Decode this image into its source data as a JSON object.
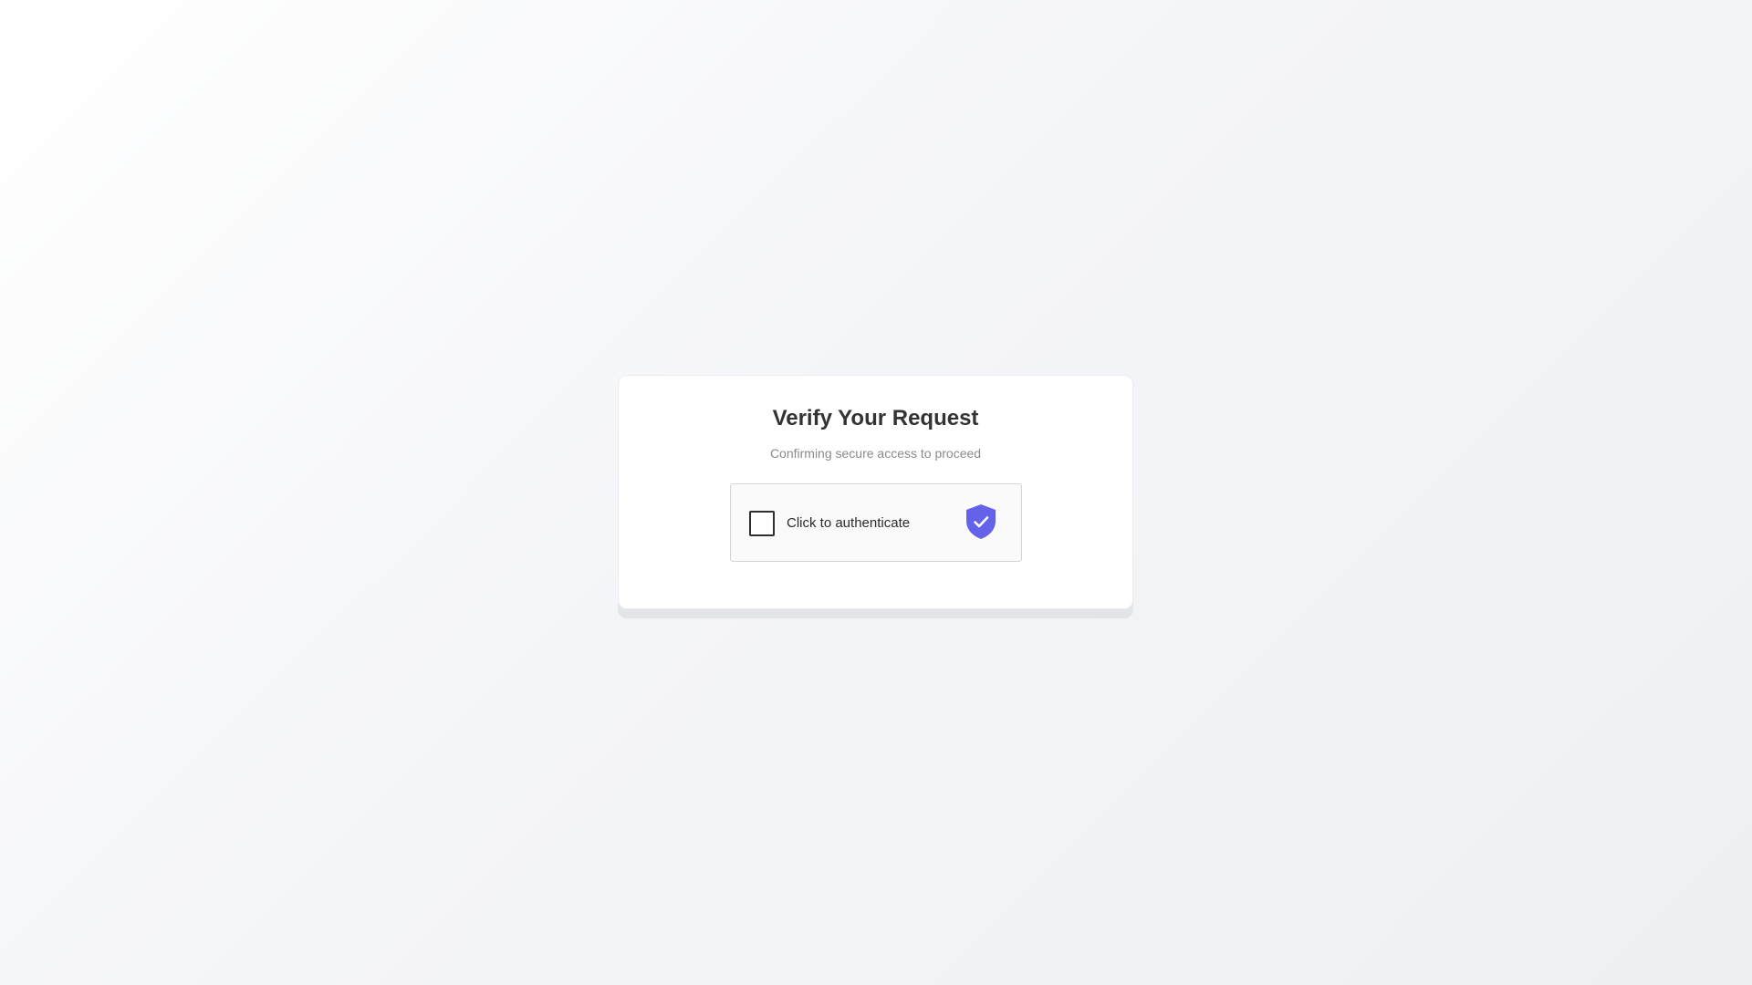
{
  "card": {
    "title": "Verify Your Request",
    "subtitle": "Confirming secure access to proceed"
  },
  "widget": {
    "checkbox_label": "Click to authenticate",
    "checked": false,
    "icon": "shield-check-icon"
  },
  "colors": {
    "accent": "#6362e8",
    "background": "#f4f5f8",
    "card": "#ffffff"
  }
}
